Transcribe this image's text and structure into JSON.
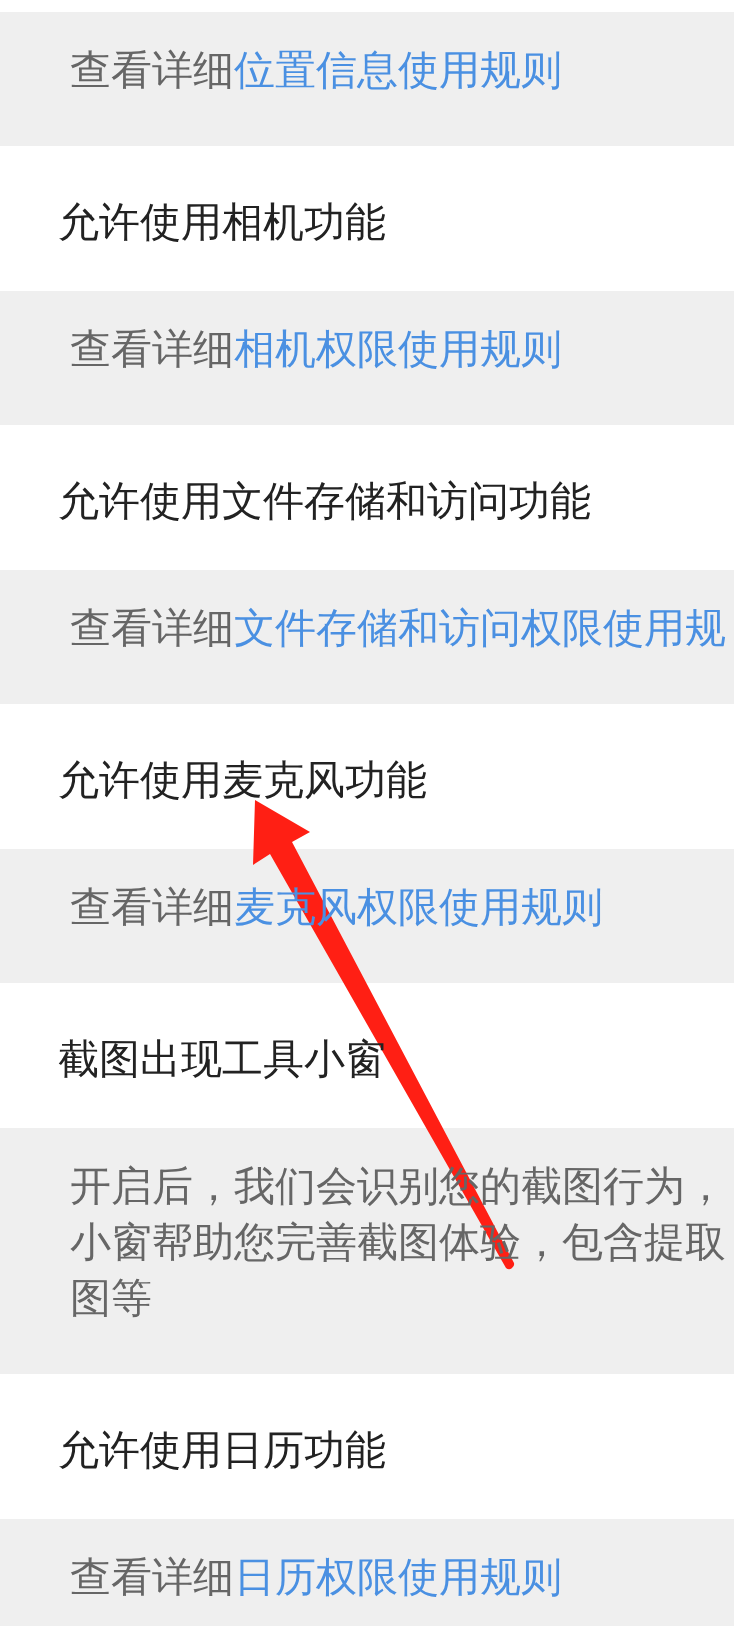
{
  "items": [
    {
      "kind": "link_note",
      "prefix": "查看详细",
      "link": "位置信息使用规则"
    },
    {
      "kind": "setting",
      "label": "允许使用相机功能"
    },
    {
      "kind": "link_note",
      "prefix": "查看详细",
      "link": "相机权限使用规则"
    },
    {
      "kind": "setting",
      "label": "允许使用文件存储和访问功能"
    },
    {
      "kind": "link_note",
      "prefix": "查看详细",
      "link": "文件存储和访问权限使用规"
    },
    {
      "kind": "setting",
      "label": "允许使用麦克风功能"
    },
    {
      "kind": "link_note",
      "prefix": "查看详细",
      "link": "麦克风权限使用规则"
    },
    {
      "kind": "setting",
      "label": "截图出现工具小窗"
    },
    {
      "kind": "description",
      "lines": [
        "开启后，我们会识别您的截图行为，",
        "小窗帮助您完善截图体验，包含提取",
        "图等"
      ]
    },
    {
      "kind": "setting",
      "label": "允许使用日历功能"
    },
    {
      "kind": "link_note",
      "prefix": "查看详细",
      "link": "日历权限使用规则"
    }
  ]
}
